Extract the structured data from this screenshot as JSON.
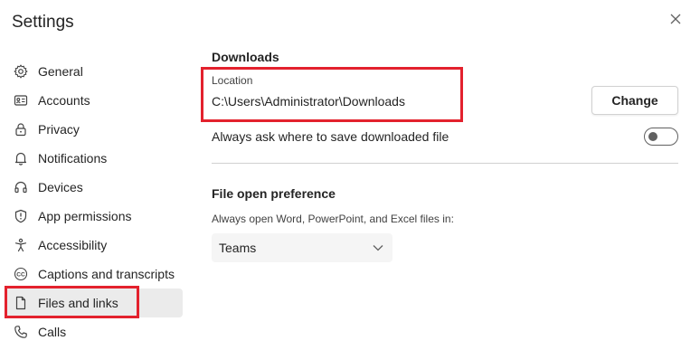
{
  "window": {
    "title": "Settings",
    "close_icon": "close-icon"
  },
  "sidebar": {
    "items": [
      {
        "label": "General",
        "icon": "gear-icon"
      },
      {
        "label": "Accounts",
        "icon": "id-card-icon"
      },
      {
        "label": "Privacy",
        "icon": "lock-icon"
      },
      {
        "label": "Notifications",
        "icon": "bell-icon"
      },
      {
        "label": "Devices",
        "icon": "headset-icon"
      },
      {
        "label": "App permissions",
        "icon": "shield-icon"
      },
      {
        "label": "Accessibility",
        "icon": "accessibility-icon"
      },
      {
        "label": "Captions and transcripts",
        "icon": "cc-icon"
      },
      {
        "label": "Files and links",
        "icon": "file-icon",
        "active": true
      },
      {
        "label": "Calls",
        "icon": "phone-icon"
      }
    ]
  },
  "downloads": {
    "title": "Downloads",
    "location_label": "Location",
    "location_path": "C:\\Users\\Administrator\\Downloads",
    "change_label": "Change",
    "always_ask_label": "Always ask where to save downloaded file",
    "always_ask_enabled": false
  },
  "file_open": {
    "title": "File open preference",
    "description": "Always open Word, PowerPoint, and Excel files in:",
    "selected": "Teams"
  },
  "colors": {
    "annotation": "#e3212d",
    "active_bg": "#ebebeb"
  }
}
